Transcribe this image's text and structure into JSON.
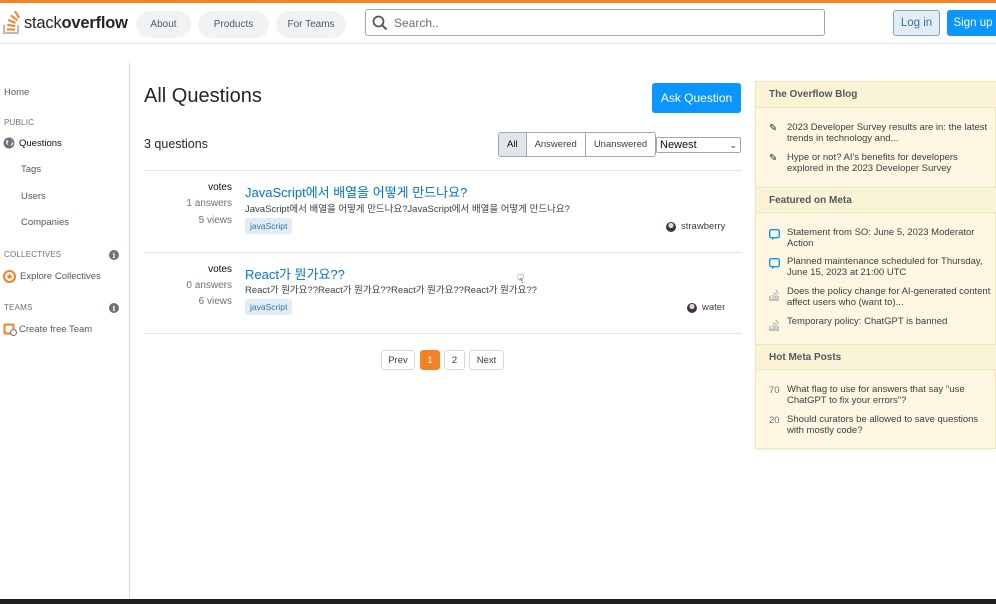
{
  "brand": {
    "prefix": "stack",
    "suffix": "overflow"
  },
  "nav": {
    "about": "About",
    "products": "Products",
    "for_teams": "For Teams"
  },
  "search": {
    "placeholder": "Search.."
  },
  "auth": {
    "login": "Log in",
    "signup": "Sign up"
  },
  "sidebar": {
    "home": "Home",
    "public_label": "PUBLIC",
    "questions": "Questions",
    "tags": "Tags",
    "users": "Users",
    "companies": "Companies",
    "collectives_label": "COLLECTIVES",
    "explore_collectives": "Explore Collectives",
    "teams_label": "TEAMS",
    "create_team": "Create free Team"
  },
  "main": {
    "title": "All Questions",
    "ask_button": "Ask Question",
    "count": "3 questions",
    "filters": [
      "All",
      "Answered",
      "Unanswered"
    ],
    "sort": "Newest",
    "questions": [
      {
        "votes": "votes",
        "answers": "1 answers",
        "views": "5 views",
        "title": "JavaScript에서 배열을 어떻게 만드나요?",
        "excerpt": "JavaScript에서 배열을 어떻게 만드나요?JavaScript에서 배열을 어떻게 만드나요?",
        "tag": "javaScript",
        "user": "strawberry"
      },
      {
        "votes": "votes",
        "answers": "0 answers",
        "views": "6 views",
        "title": "React가 뭔가요??",
        "excerpt": "React가 뭔가요??React가 뭔가요??React가 뭔가요??React가 뭔가요??",
        "tag": "javaScript",
        "user": "water"
      }
    ],
    "pagination": {
      "prev": "Prev",
      "pages": [
        "1",
        "2"
      ],
      "current": "1",
      "next": "Next"
    }
  },
  "right": {
    "blog_title": "The Overflow Blog",
    "blog_items": [
      "2023 Developer Survey results are in: the latest trends in technology and...",
      "Hype or not? AI's benefits for developers explored in the 2023 Developer Survey"
    ],
    "meta_title": "Featured on Meta",
    "meta_items": [
      "Statement from SO: June 5, 2023 Moderator Action",
      "Planned maintenance scheduled for Thursday, June 15, 2023 at 21:00 UTC",
      "Does the policy change for AI-generated content affect users who (want to)...",
      "Temporary policy: ChatGPT is banned"
    ],
    "hot_title": "Hot Meta Posts",
    "hot_items": [
      {
        "score": "70",
        "text": "What flag to use for answers that say \"use ChatGPT to fix your errors\"?"
      },
      {
        "score": "20",
        "text": "Should curators be allowed to save questions with mostly code?"
      }
    ]
  },
  "colors": {
    "accent": "#f48225",
    "primary": "#0a95ff",
    "link": "#0074cc",
    "tag_bg": "#e1ecf4",
    "sidebar_bg": "#fdf7e2"
  }
}
